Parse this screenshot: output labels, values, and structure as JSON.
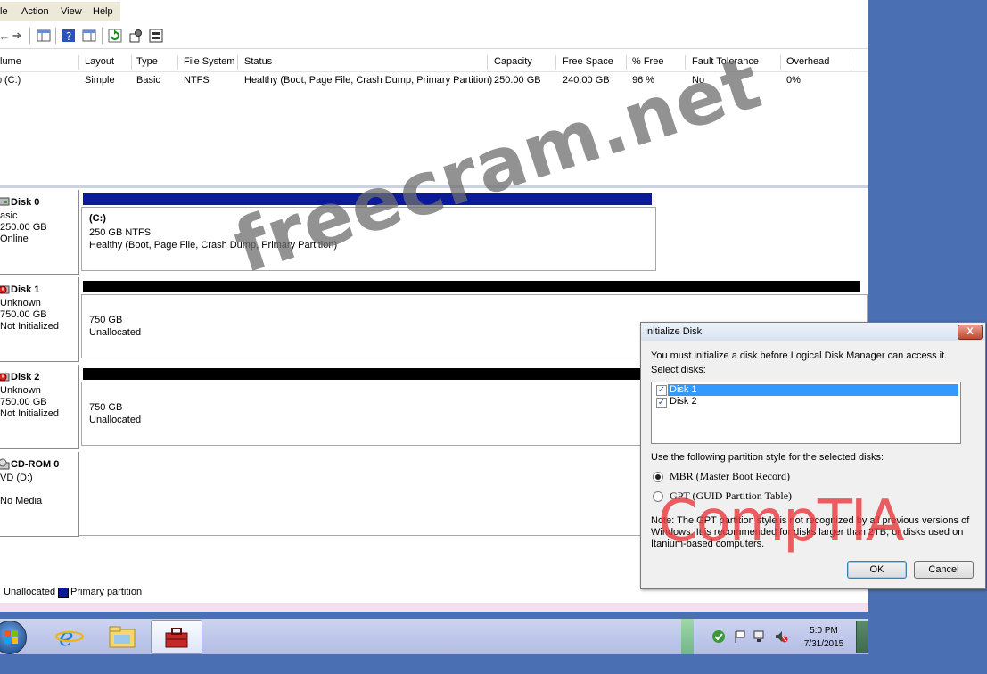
{
  "menu": {
    "file": "le",
    "action": "Action",
    "view": "View",
    "help": "Help"
  },
  "toolbar": {
    "back_icon": "back-arrow-icon",
    "forward_icon": "forward-arrow-icon"
  },
  "volume_table": {
    "headers": [
      "lume",
      "Layout",
      "Type",
      "File System",
      "Status",
      "Capacity",
      "Free Space",
      "% Free",
      "Fault Tolerance",
      "Overhead"
    ],
    "rows": [
      [
        "(C:)",
        "Simple",
        "Basic",
        "NTFS",
        "Healthy (Boot, Page File, Crash Dump, Primary Partition)",
        "250.00 GB",
        "240.00 GB",
        "96 %",
        "No",
        "0%"
      ]
    ]
  },
  "disks": [
    {
      "name": "Disk 0",
      "type": "asic",
      "size": "250.00 GB",
      "status": "Online",
      "partition_title": "(C:)",
      "partition_size": "250 GB NTFS",
      "partition_status": "Healthy (Boot, Page File, Crash Dump, Primary Partition)",
      "bar_color": "#0a1a9a"
    },
    {
      "name": "Disk 1",
      "type": "Unknown",
      "size": "750.00 GB",
      "status": "Not Initialized",
      "partition_title": "",
      "partition_size": "750 GB",
      "partition_status": "Unallocated",
      "bar_color": "#000000"
    },
    {
      "name": "Disk 2",
      "type": "Unknown",
      "size": "750.00 GB",
      "status": "Not Initialized",
      "partition_title": "",
      "partition_size": "750 GB",
      "partition_status": "Unallocated",
      "bar_color": "#000000"
    },
    {
      "name": "CD-ROM 0",
      "type": "VD (D:)",
      "size": "",
      "status": "No Media"
    }
  ],
  "legend": {
    "unallocated": "Unallocated",
    "primary": "Primary partition",
    "primary_color": "#0a1a9a"
  },
  "dialog": {
    "title": "Initialize Disk",
    "close_label": "X",
    "message": "You must initialize a disk before Logical Disk Manager can access it.",
    "select_label": "Select disks:",
    "disk_items": [
      {
        "label": "Disk 1",
        "checked": true,
        "selected": true
      },
      {
        "label": "Disk 2",
        "checked": true,
        "selected": false
      }
    ],
    "partition_style_label": "Use the following partition style for the selected disks:",
    "option_mbr": "MBR (Master Boot Record)",
    "option_gpt": "GPT (GUID Partition Table)",
    "selected_option": "MBR",
    "note_line1": "Note: The GPT partition style is not recognized by all previous versions of",
    "note_line2": "Windows. It is recommended for disks larger than 2TB, or disks used on",
    "note_line3": "Itanium-based computers.",
    "ok_label": "OK",
    "cancel_label": "Cancel"
  },
  "taskbar": {
    "time": "5:0 PM",
    "date": "7/31/2015"
  },
  "watermarks": {
    "freecram": "freecram.net",
    "comptia": "CompTIA"
  },
  "colors": {
    "desktop": "#4a6fb3",
    "selection": "#3399ff",
    "comptia_red": "#e8373b"
  }
}
